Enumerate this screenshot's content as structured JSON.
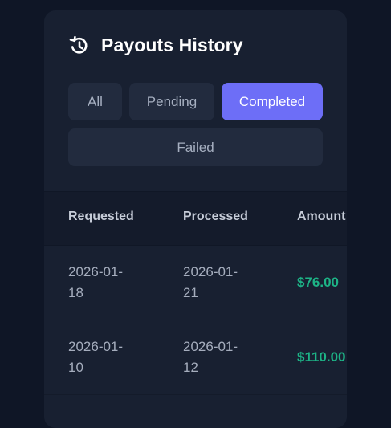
{
  "header": {
    "icon": "history-icon",
    "title": "Payouts History"
  },
  "filters": {
    "all": "All",
    "pending": "Pending",
    "completed": "Completed",
    "failed": "Failed",
    "active": "completed",
    "active_color": "#6d6ef7"
  },
  "table": {
    "columns": [
      "Requested",
      "Processed",
      "Amount"
    ],
    "rows": [
      {
        "requested": "2026-01-\n18",
        "processed": "2026-01-\n21",
        "amount": "$76.00"
      },
      {
        "requested": "2026-01-\n10",
        "processed": "2026-01-\n12",
        "amount": "$110.00"
      }
    ],
    "amount_color": "#1db386"
  }
}
